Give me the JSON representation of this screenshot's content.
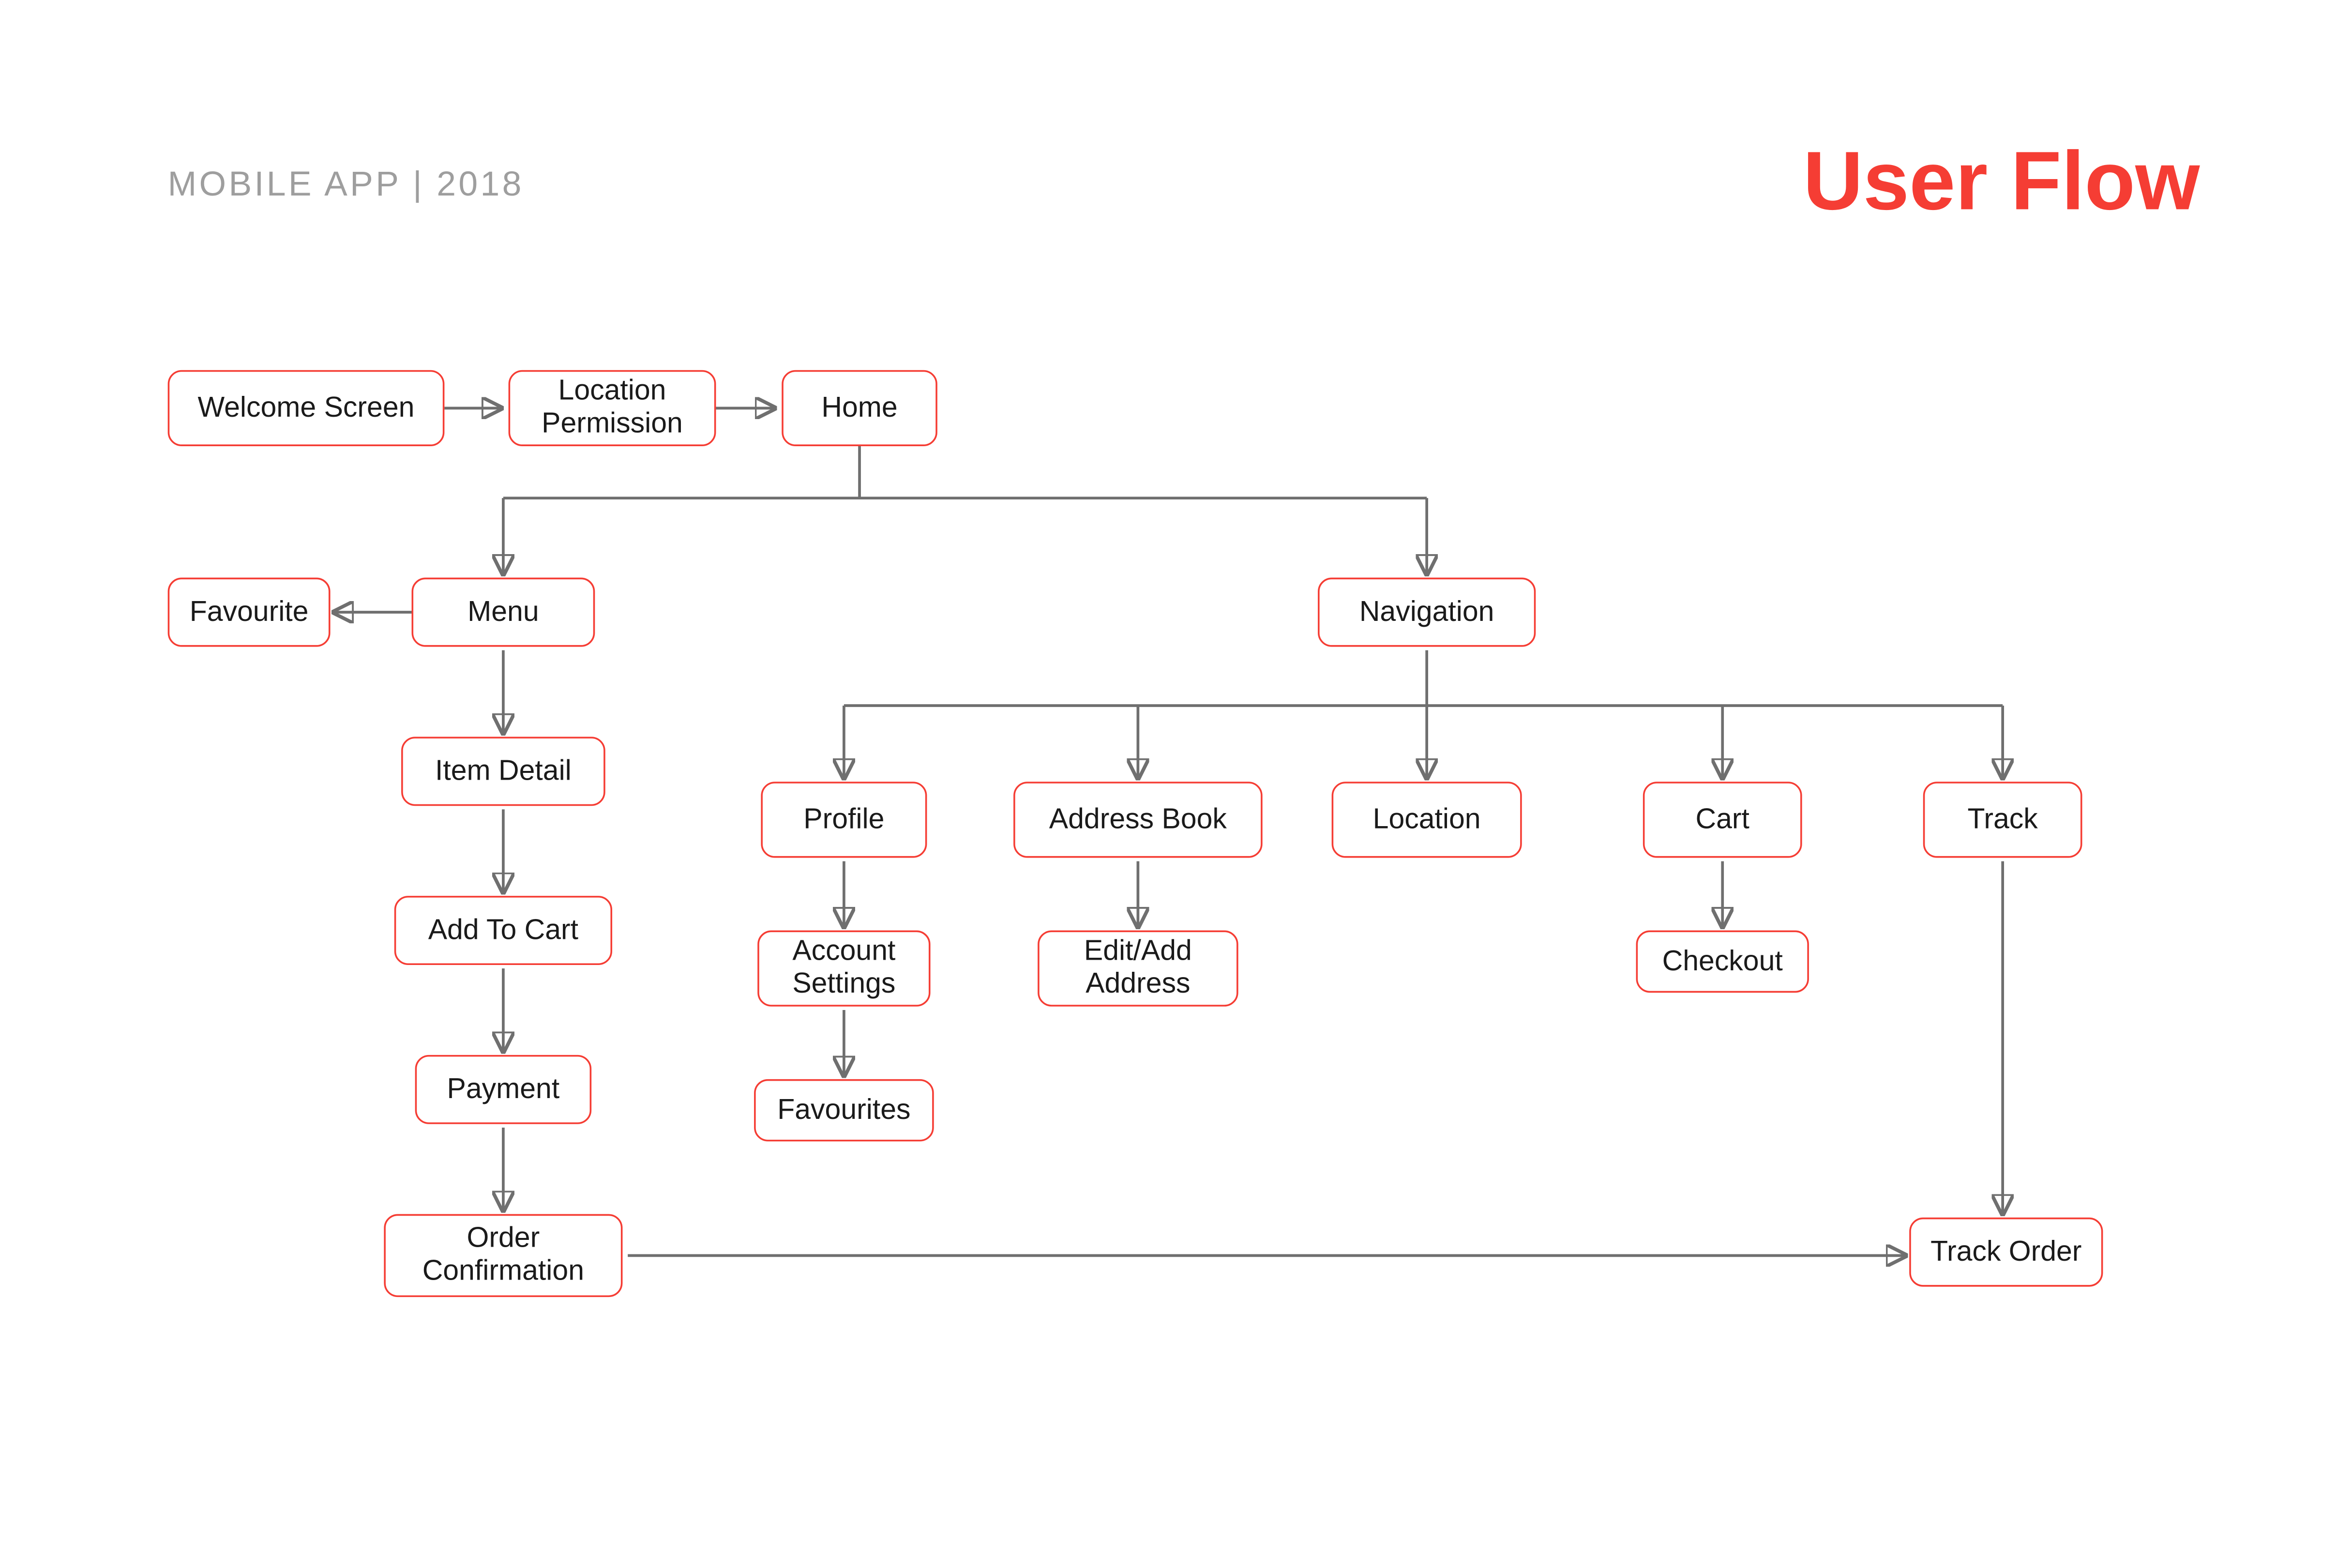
{
  "header": {
    "left": "MOBILE APP  |  2018",
    "right": "User Flow"
  },
  "colors": {
    "accent": "#F53D34",
    "muted": "#9e9e9e",
    "line": "#6f6f6f",
    "text": "#1a1a1a"
  },
  "nodes": {
    "welcome_screen": "Welcome Screen",
    "location_permission": "Location Permission",
    "home": "Home",
    "favourite": "Favourite",
    "menu": "Menu",
    "navigation": "Navigation",
    "item_detail": "Item Detail",
    "add_to_cart": "Add To Cart",
    "payment": "Payment",
    "order_confirmation": "Order Confirmation",
    "profile": "Profile",
    "address_book": "Address Book",
    "location": "Location",
    "cart": "Cart",
    "track": "Track",
    "account_settings": "Account Settings",
    "edit_add_address": "Edit/Add Address",
    "checkout": "Checkout",
    "favourites": "Favourites",
    "track_order": "Track Order"
  },
  "edges": [
    {
      "from": "welcome_screen",
      "to": "location_permission"
    },
    {
      "from": "location_permission",
      "to": "home"
    },
    {
      "from": "home",
      "to": "menu"
    },
    {
      "from": "home",
      "to": "navigation"
    },
    {
      "from": "menu",
      "to": "favourite"
    },
    {
      "from": "menu",
      "to": "item_detail"
    },
    {
      "from": "item_detail",
      "to": "add_to_cart"
    },
    {
      "from": "add_to_cart",
      "to": "payment"
    },
    {
      "from": "payment",
      "to": "order_confirmation"
    },
    {
      "from": "order_confirmation",
      "to": "track_order"
    },
    {
      "from": "navigation",
      "to": "profile"
    },
    {
      "from": "navigation",
      "to": "address_book"
    },
    {
      "from": "navigation",
      "to": "location"
    },
    {
      "from": "navigation",
      "to": "cart"
    },
    {
      "from": "navigation",
      "to": "track"
    },
    {
      "from": "profile",
      "to": "account_settings"
    },
    {
      "from": "account_settings",
      "to": "favourites"
    },
    {
      "from": "address_book",
      "to": "edit_add_address"
    },
    {
      "from": "cart",
      "to": "checkout"
    },
    {
      "from": "track",
      "to": "track_order"
    }
  ]
}
